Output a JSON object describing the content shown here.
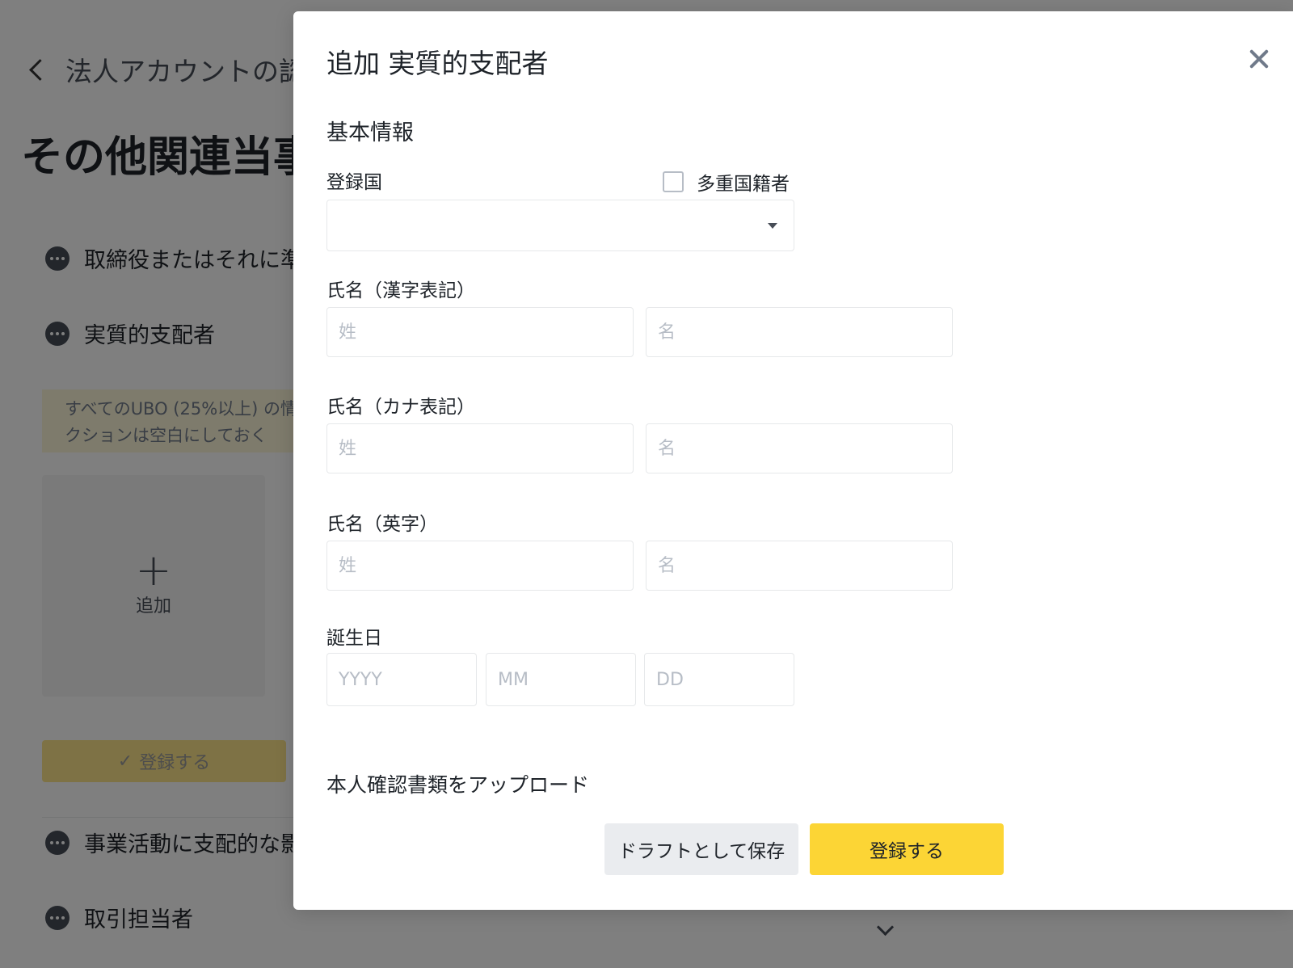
{
  "background": {
    "back_title": "法人アカウントの認",
    "page_title": "その他関連当事",
    "sections": [
      {
        "label": "取締役またはそれに準"
      },
      {
        "label": "実質的支配者"
      },
      {
        "label": "事業活動に支配的な影"
      },
      {
        "label": "取引担当者"
      }
    ],
    "notice_line1": "すべてのUBO (25%以上) の情",
    "notice_line2": "クションは空白にしておく",
    "add_label": "追加",
    "submit_label": "登録する",
    "check_glyph": "✓"
  },
  "modal": {
    "title": "追加 実質的支配者",
    "basic_info_heading": "基本情報",
    "country_label": "登録国",
    "country_value": "",
    "multi_nationality_label": "多重国籍者",
    "kanji_name_label": "氏名（漢字表記）",
    "kana_name_label": "氏名（カナ表記）",
    "english_name_label": "氏名（英字）",
    "last_name_placeholder": "姓",
    "first_name_placeholder": "名",
    "birthday_label": "誕生日",
    "year_placeholder": "YYYY",
    "month_placeholder": "MM",
    "day_placeholder": "DD",
    "upload_heading": "本人確認書類をアップロード",
    "draft_button": "ドラフトとして保存",
    "submit_button": "登録する"
  },
  "colors": {
    "accent": "#FCD535",
    "notice_bg": "#FDF6D8",
    "overlay": "rgba(0,0,0,0.5)"
  }
}
